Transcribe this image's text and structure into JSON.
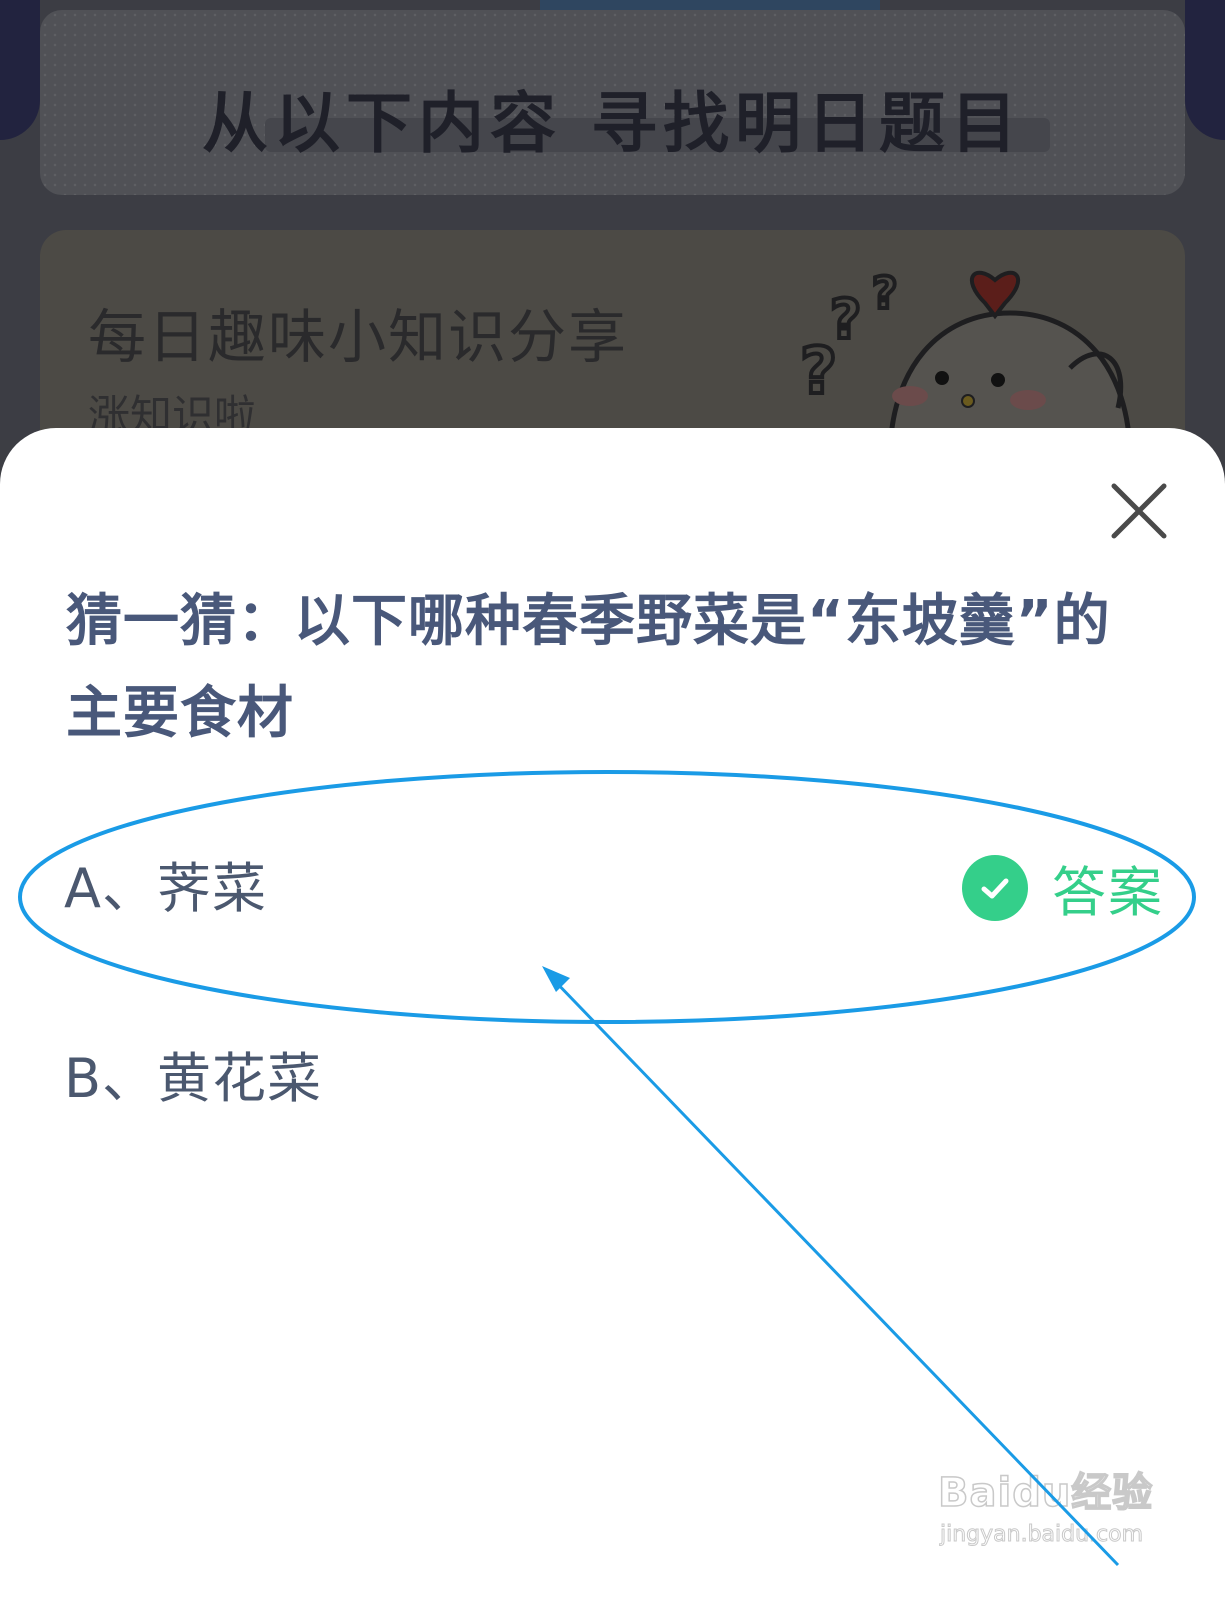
{
  "background": {
    "card_title": "从以下内容  寻找明日题目",
    "knowledge_title": "每日趣味小知识分享",
    "knowledge_subtitle": "涨知识啦"
  },
  "modal": {
    "question": "猜一猜：以下哪种春季野菜是“东坡羹”的主要食材",
    "options": [
      {
        "label": "A、荠菜",
        "is_answer": true
      },
      {
        "label": "B、黄花菜",
        "is_answer": false
      }
    ],
    "answer_tag": "答案",
    "close_icon": "close-icon"
  },
  "watermark": {
    "text": "Baidu经验",
    "sub": "jingyan.baidu.com"
  },
  "colors": {
    "accent_green": "#34cf8a",
    "question_text": "#49587a",
    "annotation_blue": "#1a9be6"
  }
}
